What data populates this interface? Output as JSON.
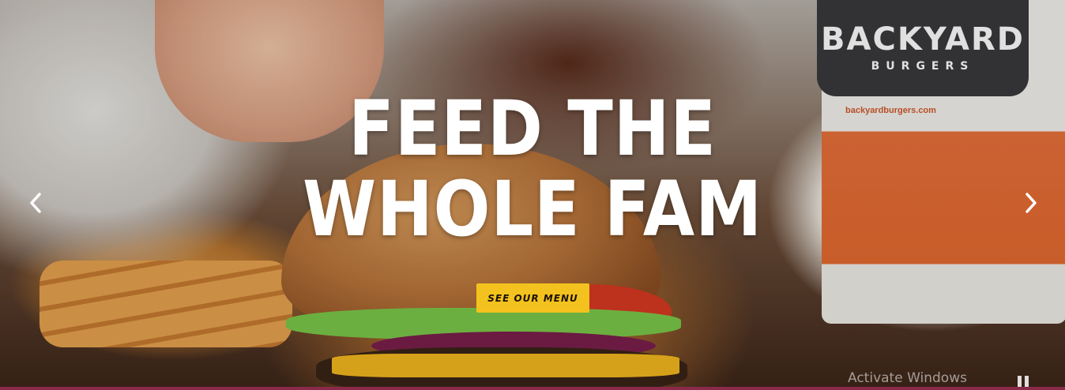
{
  "hero": {
    "headline_line1": "FEED THE",
    "headline_line2": "WHOLE FAM",
    "cta_label": "SEE OUR MENU",
    "cta_color": "#f4c21e"
  },
  "carousel": {
    "prev_icon": "chevron-left-icon",
    "next_icon": "chevron-right-icon",
    "pause_icon": "pause-icon"
  },
  "image": {
    "cup_logo_line1": "BACKYARD",
    "cup_logo_line2": "BURGERS",
    "cup_url": "backyardburgers.com"
  },
  "overlay": {
    "watermark": "Activate Windows"
  }
}
